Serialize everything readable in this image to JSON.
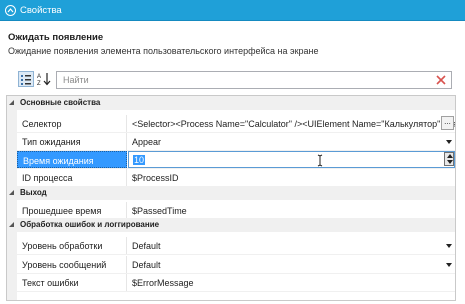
{
  "panel": {
    "title": "Свойства"
  },
  "activity": {
    "title": "Ожидать появление",
    "description": "Ожидание появления элемента пользовательского интерфейса на экране"
  },
  "search": {
    "placeholder": "Найти"
  },
  "categories": {
    "main": "Основные свойства",
    "output": "Выход",
    "errors": "Обработка ошибок и логгирование"
  },
  "properties": {
    "selector": {
      "name": "Селектор",
      "value": "<Selector><Process Name=\"Calculator\" /><UIElement Name=\"Калькулятор\" Cla"
    },
    "wait_type": {
      "name": "Тип ожидания",
      "value": "Appear"
    },
    "wait_time": {
      "name": "Время ожидания",
      "value": "10"
    },
    "process_id": {
      "name": "ID процесса",
      "value": "$ProcessID"
    },
    "passed_time": {
      "name": "Прошедшее время",
      "value": "$PassedTime"
    },
    "handling_level": {
      "name": "Уровень обработки",
      "value": "Default"
    },
    "message_level": {
      "name": "Уровень сообщений",
      "value": "Default"
    },
    "error_text": {
      "name": "Текст ошибки",
      "value": "$ErrorMessage"
    }
  },
  "colors": {
    "titlebar": "#1fa0d8",
    "selection": "#3399ff"
  },
  "icons": [
    "chevron-up-icon",
    "categorized-icon",
    "sort-az-icon",
    "clear-icon",
    "ellipsis-icon",
    "dropdown-icon",
    "spinner-icon",
    "text-cursor-icon"
  ]
}
